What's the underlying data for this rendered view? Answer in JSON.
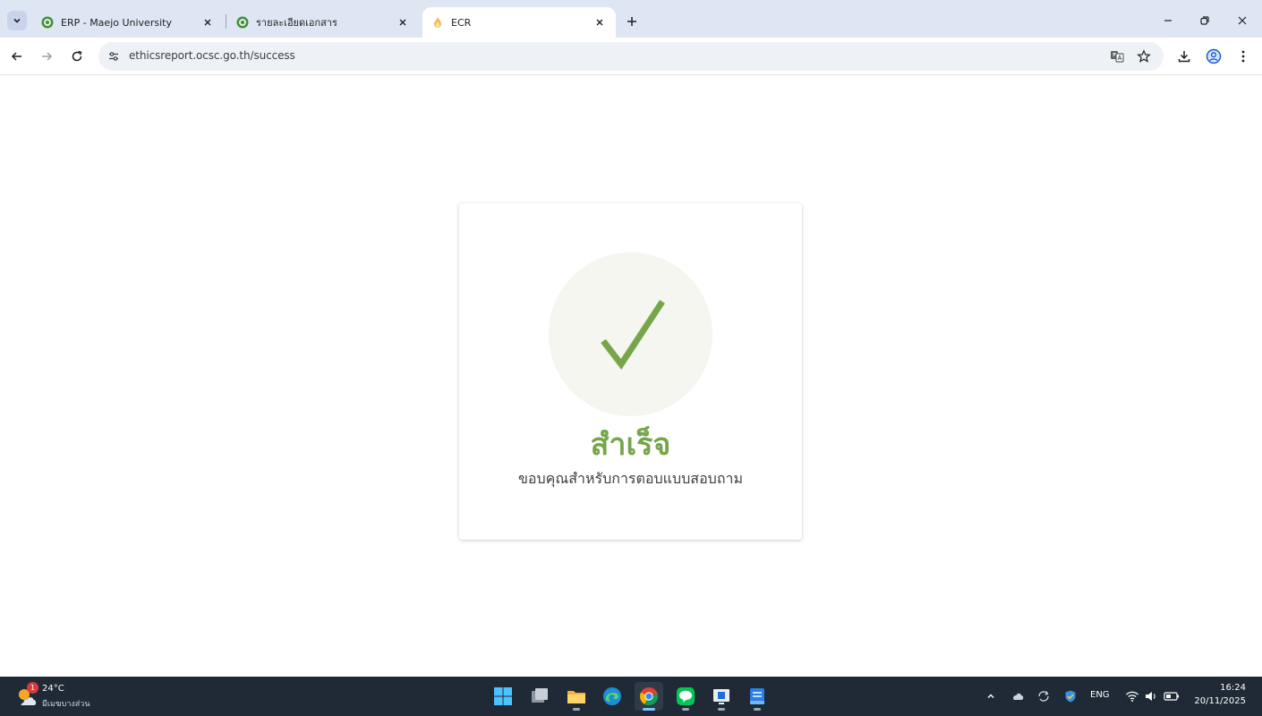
{
  "browser": {
    "tabs": [
      {
        "title": "ERP - Maejo University",
        "active": false,
        "icon": "maejo-logo-icon"
      },
      {
        "title": "รายละเอียดเอกสาร",
        "active": false,
        "icon": "maejo-logo-icon"
      },
      {
        "title": "ECR",
        "active": true,
        "icon": "flame-icon"
      }
    ],
    "new_tab_label": "+",
    "url": "ethicsreport.ocsc.go.th/success"
  },
  "page": {
    "success_title": "สำเร็จ",
    "success_message": "ขอบคุณสำหรับการตอบแบบสอบถาม",
    "accent_color": "#76a54a",
    "circle_color": "#f4f6ef"
  },
  "taskbar": {
    "weather": {
      "temp": "24°C",
      "desc": "มีเมฆบางส่วน",
      "badge": "1"
    },
    "apps": [
      "start-icon",
      "task-view-icon",
      "file-explorer-icon",
      "edge-icon",
      "chrome-icon",
      "line-icon",
      "app-icon",
      "app-icon"
    ],
    "active_app": "chrome-icon",
    "language": "ENG",
    "time": "16:24",
    "date": "20/11/2025"
  }
}
